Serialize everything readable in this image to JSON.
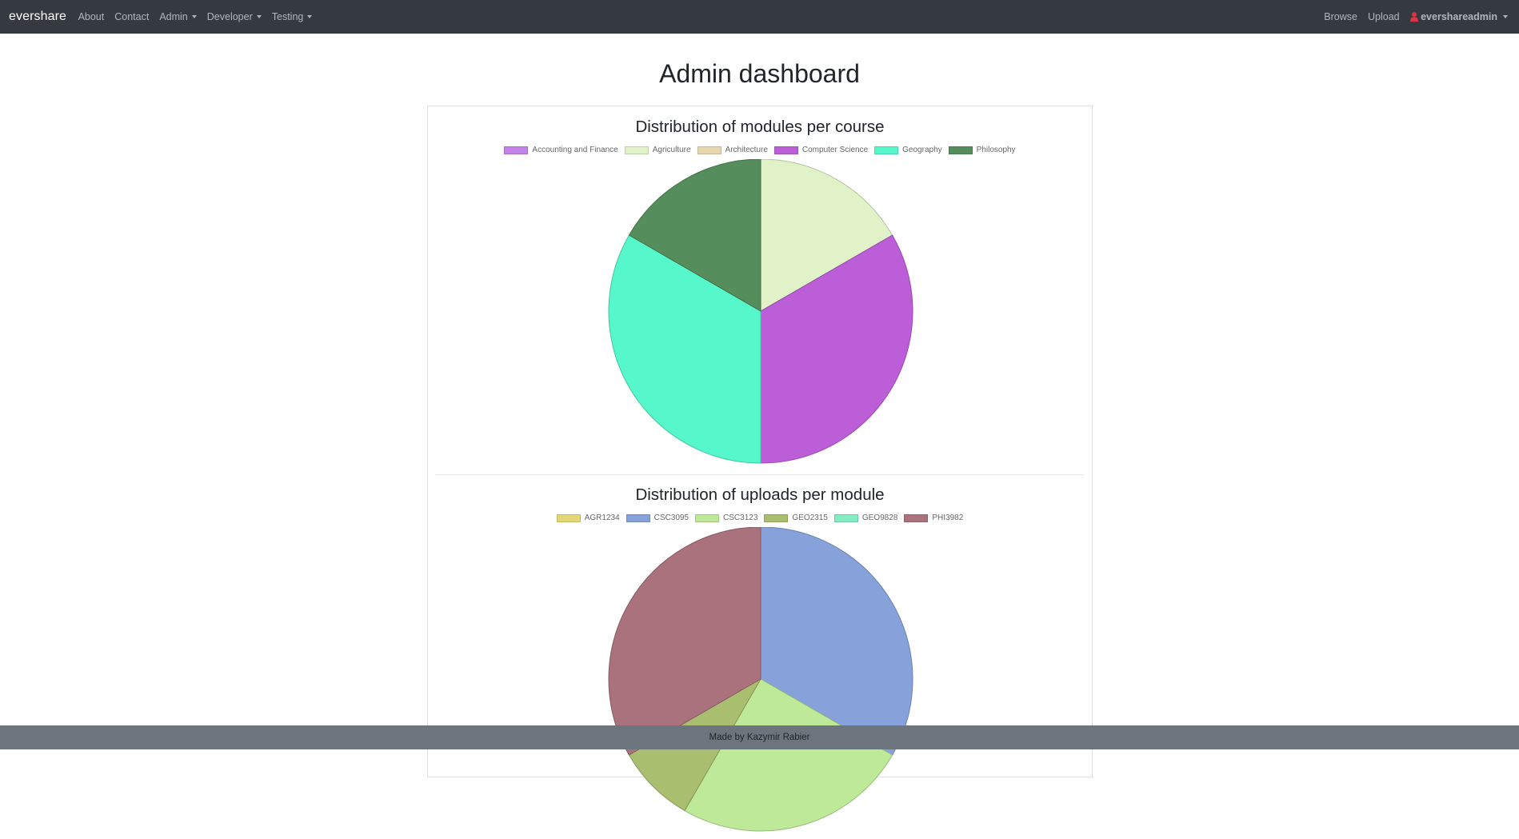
{
  "navbar": {
    "brand": "evershare",
    "links": [
      {
        "label": "About",
        "dropdown": false
      },
      {
        "label": "Contact",
        "dropdown": false
      },
      {
        "label": "Admin",
        "dropdown": true
      },
      {
        "label": "Developer",
        "dropdown": true
      },
      {
        "label": "Testing",
        "dropdown": true
      }
    ],
    "right_links": [
      {
        "label": "Browse"
      },
      {
        "label": "Upload"
      }
    ],
    "user": {
      "label": "evershareadmin",
      "icon": "user-icon",
      "icon_color": "#dc3545"
    }
  },
  "page": {
    "title": "Admin dashboard"
  },
  "chart_data": [
    {
      "type": "pie",
      "title": "Distribution of modules per course",
      "categories": [
        "Accounting and Finance",
        "Agriculture",
        "Architecture",
        "Computer Science",
        "Geography",
        "Philosophy"
      ],
      "values": [
        0,
        1,
        0,
        2,
        2,
        1
      ],
      "colors": [
        "#c383e8",
        "#e1f2c9",
        "#e6d7b0",
        "#bc5ed8",
        "#55f7cb",
        "#558d5c"
      ],
      "legend": "top"
    },
    {
      "type": "pie",
      "title": "Distribution of uploads per module",
      "categories": [
        "AGR1234",
        "CSC3095",
        "CSC3123",
        "GEO2315",
        "GEO9828",
        "PHI3982"
      ],
      "values": [
        0,
        2,
        1.5,
        0.5,
        0,
        2
      ],
      "colors": [
        "#e2d877",
        "#87a2db",
        "#bde998",
        "#a9be6f",
        "#84ecc3",
        "#a9727c"
      ],
      "legend": "top"
    }
  ],
  "footer": {
    "text": "Made by Kazymir Rabier"
  }
}
